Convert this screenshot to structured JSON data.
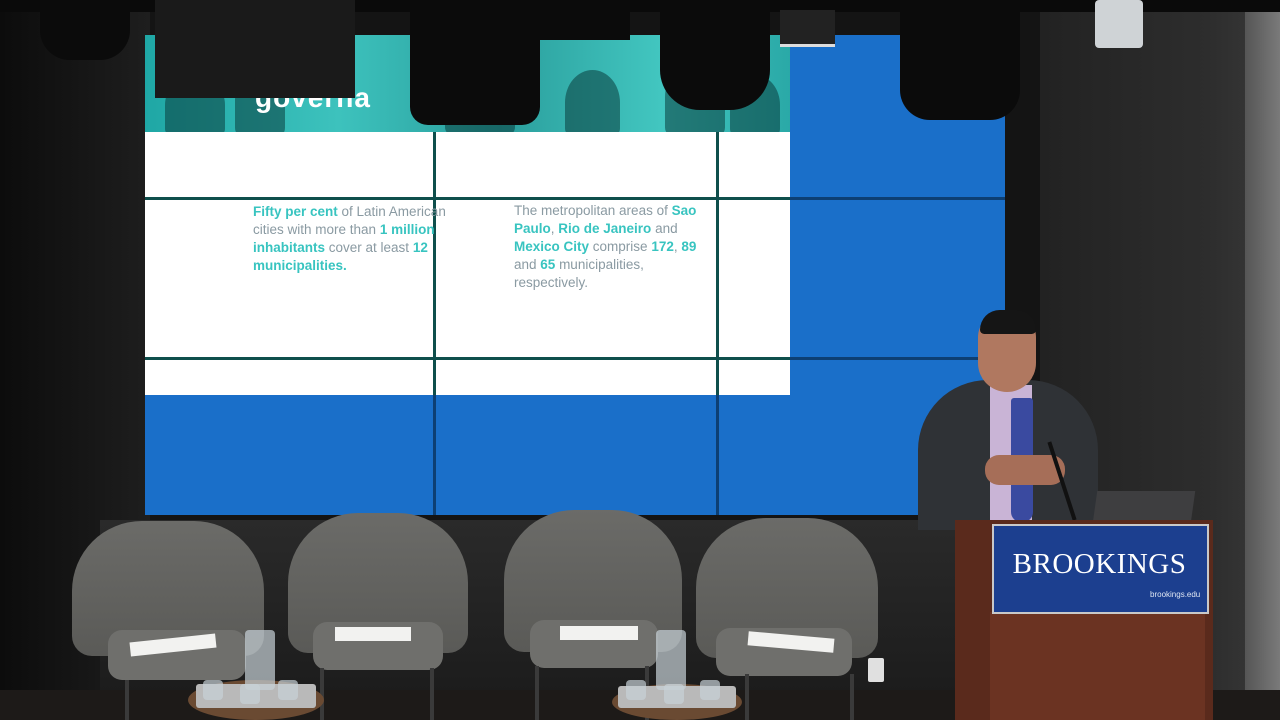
{
  "slide": {
    "title": "governa",
    "left_text_segments": [
      {
        "t": "Fifty per cent",
        "hl": true
      },
      {
        "t": " of Latin American cities with more than ",
        "hl": false
      },
      {
        "t": "1 million inhabitants",
        "hl": true
      },
      {
        "t": " cover at least ",
        "hl": false
      },
      {
        "t": "12 municipalities.",
        "hl": true
      }
    ],
    "right_text_segments": [
      {
        "t": "The metropolitan areas of ",
        "hl": false
      },
      {
        "t": "Sao Paulo",
        "hl": true
      },
      {
        "t": ", ",
        "hl": false
      },
      {
        "t": "Rio de Janeiro",
        "hl": true
      },
      {
        "t": " and ",
        "hl": false
      },
      {
        "t": "Mexico City",
        "hl": true
      },
      {
        "t": " comprise ",
        "hl": false
      },
      {
        "t": "172",
        "hl": true
      },
      {
        "t": ", ",
        "hl": false
      },
      {
        "t": "89",
        "hl": true
      },
      {
        "t": " and ",
        "hl": false
      },
      {
        "t": "65",
        "hl": true
      },
      {
        "t": " municipalities, respectively.",
        "hl": false
      }
    ]
  },
  "podium": {
    "brand": "BROOKINGS",
    "url": "brookings.edu"
  },
  "colors": {
    "highlight": "#38c4c0",
    "screen_blue": "#1a6fc9",
    "podium_sign": "#1c3f8f"
  },
  "icons": [
    "stage-light-icon",
    "microphone-icon",
    "laptop-icon",
    "power-outlet-icon"
  ]
}
